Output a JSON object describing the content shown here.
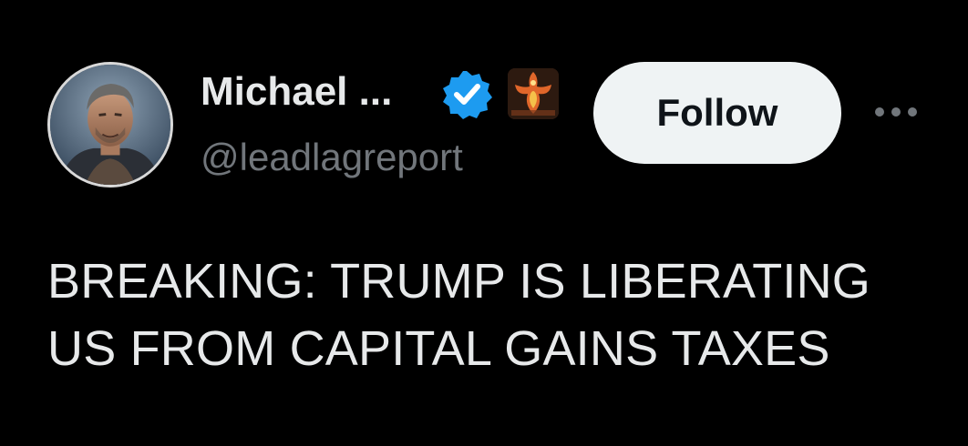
{
  "author": {
    "display_name": "Michael ...",
    "handle": "@leadlagreport",
    "avatar_icon": "profile-portrait-avatar",
    "verified_icon": "verified-badge-icon",
    "affiliate_icon": "phoenix-affiliate-badge"
  },
  "actions": {
    "follow_label": "Follow",
    "more_icon": "more-options-icon"
  },
  "tweet": {
    "text": "BREAKING: TRUMP IS LIBERATING US FROM CAPITAL GAINS TAXES"
  },
  "colors": {
    "background": "#000000",
    "primary_text": "#e7e9ea",
    "secondary_text": "#71767b",
    "verified_blue": "#1d9bf0",
    "follow_button_bg": "#eff3f4",
    "follow_button_text": "#0f1419"
  }
}
